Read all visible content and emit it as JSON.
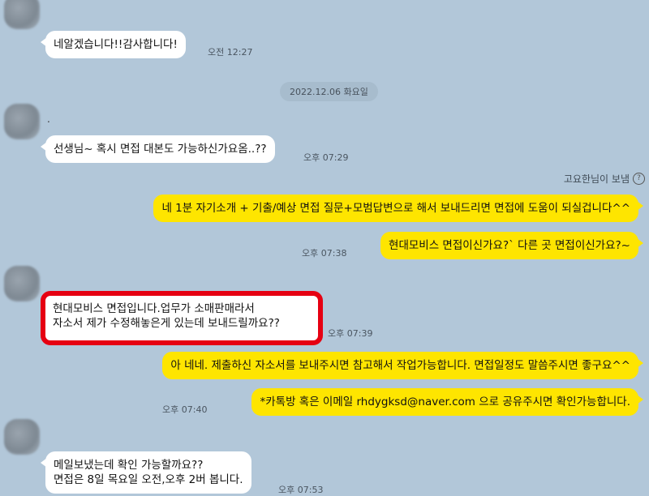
{
  "messages": {
    "m1": {
      "text": "네알겠습니다!!감사합니다!",
      "time": "오전 12:27"
    },
    "date_divider": "2022.12.06 화요일",
    "m2": {
      "sender_name": ".",
      "text": "선생님~ 혹시 면접 대본도 가능하신가요옴..??",
      "time": "오후 07:29"
    },
    "sender_note": "고요한님이 보냄",
    "m3": {
      "text": "네 1분 자기소개 + 기출/예상 면접 질문+모범답변으로 해서 보내드리면 면접에 도움이 되실겁니다^^"
    },
    "m4": {
      "text": "현대모비스 면접이신가요?` 다른 곳 면접이신가요?~",
      "time": "오후 07:38"
    },
    "m5": {
      "text": "현대모비스 면접입니다.업무가 소매판매라서\n자소서 제가 수정해놓은게 있는데 보내드릴까요??",
      "time": "오후 07:39"
    },
    "m6": {
      "text": "아 네네. 제출하신 자소서를 보내주시면 참고해서 작업가능합니다. 면접일정도 말씀주시면 좋구요^^"
    },
    "m7": {
      "text": "*카톡방 혹은 이메일 rhdygksd@naver.com 으로 공유주시면 확인가능합니다.",
      "time": "오후 07:40"
    },
    "m8": {
      "text": "메일보냈는데 확인 가능할까요??\n면접은 8일 목요일 오전,오후 2버 봅니다.",
      "time": "오후 07:53"
    }
  },
  "colors": {
    "background": "#b2c7d9",
    "my_bubble": "#fee500",
    "their_bubble": "#ffffff",
    "highlight_border": "#e60012"
  },
  "icons": {
    "avatar": "blurred-profile-avatar",
    "help": "question-circle-icon"
  }
}
